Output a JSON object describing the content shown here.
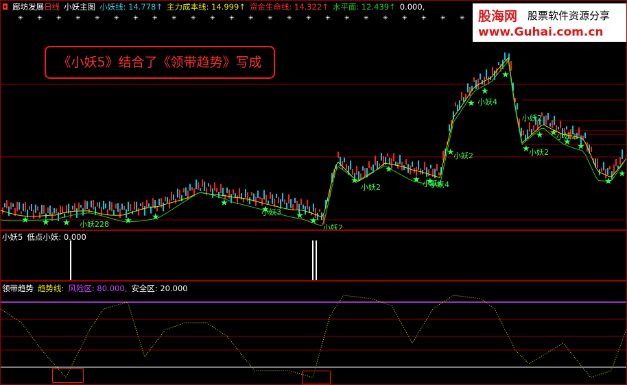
{
  "colors": {
    "bg": "#000000",
    "grid": "#8b0000",
    "up": "#ff2020",
    "down": "#00c8e6",
    "ma_yellow": "#e6e600",
    "ma_green": "#22cc22",
    "marker": "#33ff55",
    "trend": "#e6e600",
    "trend_high": "#3050ff",
    "trend_low": "#ff2020",
    "risk": "#cc44ff",
    "safe": "#ffffff"
  },
  "main": {
    "stock_name": "廊坊发展",
    "period": "日线",
    "indicator": "小妖主图",
    "xiaoyao_line": "小妖线: 14.778↑",
    "main_cost": "主力成本线: 14.999↑",
    "capital_life": "资金生命线: 14.322↑",
    "level": "水平面: 12.439↑",
    "extra": "0.000,",
    "banner": "《小妖5》结合了《领带趋势》写成",
    "marker_labels": [
      "小妖2",
      "小妖2",
      "小妖2",
      "小妖4",
      "小妖4",
      "小妖4",
      "小妖2",
      "小妖2",
      "小妖2",
      "小妖3",
      "小妖228"
    ]
  },
  "logo": {
    "brand": "股海网",
    "slogan": "股票软件资源分享",
    "url": "www.Guhai.com.cn"
  },
  "sub1": {
    "title": "小妖5",
    "value": "低点小妖: 0.000"
  },
  "sub2": {
    "title": "领带趋势",
    "trend": "趋势线:",
    "risk": "风险区: 80.000,",
    "safe": "安全区: 20.000"
  }
}
